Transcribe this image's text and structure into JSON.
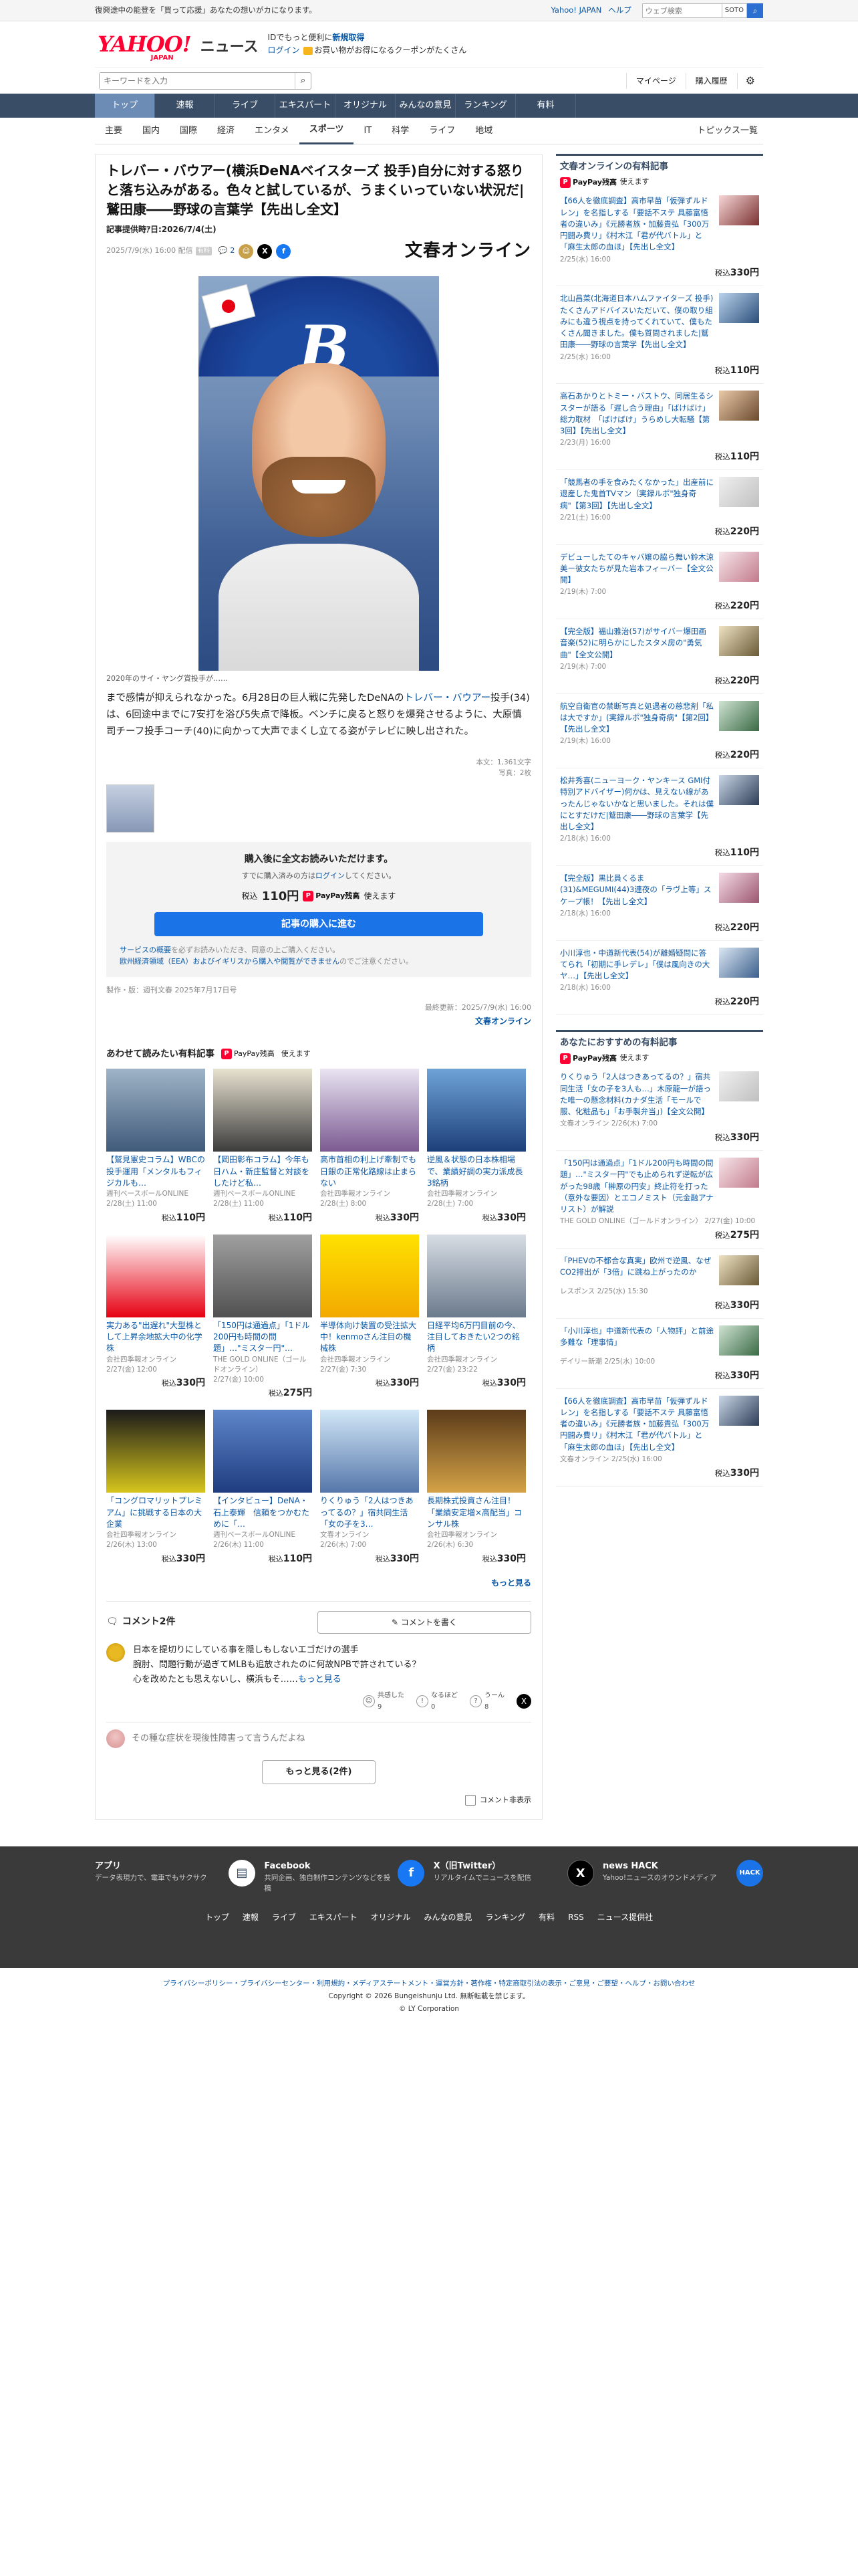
{
  "topbar": {
    "promo": "復興途中の能登を「買って応援」あなたの想いがカになります。",
    "yjapan": "Yahoo! JAPAN",
    "help": "ヘルプ",
    "search_placeholder": "ウェブ検索",
    "search_btn": "SOTO"
  },
  "header": {
    "logo": "YAHOO!",
    "logo_sub": "JAPAN",
    "logo_news": "ニュース",
    "login_line1": "IDでもっと便利に",
    "login_line1_link": "新規取得",
    "login_link": "ログイン",
    "coupon": "お買い物がお得になるクーポンがたくさん"
  },
  "search": {
    "placeholder": "キーワードを入力",
    "mypage": "マイページ",
    "purchased": "購入履歴"
  },
  "gnav": [
    "トップ",
    "速報",
    "ライブ",
    "エキスパート",
    "オリジナル",
    "みんなの意見",
    "ランキング",
    "有料"
  ],
  "snav": [
    "主要",
    "国内",
    "国際",
    "経済",
    "エンタメ",
    "スポーツ",
    "IT",
    "科学",
    "ライフ",
    "地域"
  ],
  "snav_topics": "トピックス一覧",
  "article": {
    "title": "トレバー・バウアー(横浜DeNAベイスターズ 投手)自分に対する怒りと落ち込みがある。色々と試しているが、うまくいっていない状況だ|鷲田康――野球の言葉学【先出し全文】",
    "source": "記事提供時ｱ日:2026/7/4(土)",
    "date": "2025/7/9(水) 16:00 配信",
    "badge": "有料",
    "comments": "2",
    "brand": "文春オンライン",
    "photo_caption": "2020年のサイ・ヤング賞投手が……",
    "lead_before": "まで感情が抑えられなかった。6月28日の巨人戦に先発したDeNAの",
    "lead_link": "トレバー・バウアー",
    "lead_after": "投手(34)は、6回途中までに7安打を浴び5失点で降板。ベンチに戻ると怒りを爆発させるように、大原慎司チーフ投手コーチ(40)に向かって大声でまくし立てる姿がテレビに映し出された。",
    "chars": "本文：1,361文字",
    "photos": "写真：2枚"
  },
  "pay": {
    "title": "購入後に全文お読みいただけます。",
    "sub_before": "すでに購入済みの方は",
    "sub_link": "ログイン",
    "sub_after": "してください。",
    "price_label": "税込",
    "price": "110円",
    "pp": "PayPay残高",
    "pp_use": "使えます",
    "buy": "記事の購入に進む",
    "note_link": "サービスの概要",
    "note_rest": "を必ずお読みいただき、同意の上ご購入ください。",
    "note2": "欧州経済領域（EEA）およびイギリスから購入や閲覧ができません",
    "note3": "のでご注意ください。"
  },
  "pubinfo": "製作・版：週刊文春 2025年7月17日号",
  "updated": "最終更新：2025/7/9(水) 16:00",
  "bunshun_link": "文春オンライン",
  "related": {
    "title": "あわせて読みたい有料記事",
    "pp": "PayPay残高",
    "pp_use": "使えます",
    "more": "もっと見る",
    "items": [
      {
        "title": "【鷲見憲史コラム】WBCの投手運用「メンタルもフィジカルも…",
        "src": "週刊ベースボールONLINE",
        "date": "2/28(土) 11:00",
        "price": "110円"
      },
      {
        "title": "【岡田彰布コラム】今年も日ハム・新庄監督と対談をしたけど私…",
        "src": "週刊ベースボールONLINE",
        "date": "2/28(土) 11:00",
        "price": "110円"
      },
      {
        "title": "高市首相の利上げ牽制でも日銀の正常化路線は止まらない",
        "src": "会社四季報オンライン",
        "date": "2/28(土) 8:00",
        "price": "330円"
      },
      {
        "title": "逆風＆状態の日本株相場で、業績好調の実力派成長3銘柄",
        "src": "会社四季報オンライン",
        "date": "2/28(土) 7:00",
        "price": "330円"
      },
      {
        "title": "実力ある\"出遅れ\"大型株として上昇余地拡大中の化学株",
        "src": "会社四季報オンライン",
        "date": "2/27(金) 12:00",
        "price": "330円"
      },
      {
        "title": "「150円は通過点」「1ドル200円も時間の問題」…\"ミスター円\"…",
        "src": "THE GOLD ONLINE（ゴールドオンライン）",
        "date": "2/27(金) 10:00",
        "price": "275円"
      },
      {
        "title": "半導体向け装置の受注拡大中！kenmoさん注目の機械株",
        "src": "会社四季報オンライン",
        "date": "2/27(金) 7:30",
        "price": "330円"
      },
      {
        "title": "日経平均6万円目前の今、注目しておきたい2つの銘柄",
        "src": "会社四季報オンライン",
        "date": "2/27(金) 23:22",
        "price": "330円"
      },
      {
        "title": "「コングロマリットプレミアム」に挑戦する日本の大企業",
        "src": "会社四季報オンライン",
        "date": "2/26(木) 13:00",
        "price": "330円"
      },
      {
        "title": "【インタビュー】DeNA・石上泰輝　信頼をつかむために「…",
        "src": "週刊ベースボールONLINE",
        "date": "2/26(木) 11:00",
        "price": "110円"
      },
      {
        "title": "りくりゅう「2人はつきあってるの？」宿共同生活「女の子を3…",
        "src": "文春オンライン",
        "date": "2/26(木) 7:00",
        "price": "330円"
      },
      {
        "title": "長期株式投資さん注目！「業績安定増×高配当」コンサル株",
        "src": "会社四季報オンライン",
        "date": "2/26(木) 6:30",
        "price": "330円"
      }
    ]
  },
  "comments": {
    "title": "コメント2件",
    "write": "コメントを書く",
    "c1_line1": "日本を提切りにしている事を隠しもしないエゴだけの選手",
    "c1_line2": "腕肘、問題行動が過ぎてMLBも追放されたのに何故NPBで許されている？",
    "c1_line3": "心を改めたとも思えないし、横浜もそ……",
    "c1_more": "もっと見る",
    "r1": "共感した",
    "r1n": "9",
    "r2": "なるほど",
    "r2n": "0",
    "r3": "うーん",
    "r3n": "8",
    "c2": "その種な症状を現後性障害って言うんだよね",
    "more_btn": "もっと見る(2件)",
    "hide": "コメント非表示"
  },
  "side1": {
    "title": "文春オンラインの有料記事",
    "pp": "PayPay残高",
    "pp_use": "使えます",
    "items": [
      {
        "title": "【66人を徹底調査】高市早苗「仮弾ずルドレン」を名指しする「要話不ステ 具藤富悟者の違いみ」《元勝者族・加藤貴弘「300万円闘み費リ」《村木江「君が代バトル」と「麻生太郎の血ほ」【先出し全文】",
        "date": "2/25(水) 16:00",
        "price": "330円"
      },
      {
        "title": "北山昌菜(北海道日本ハムファイターズ 投手)たくさんアドバイスいただいて、僕の取り組みにも違う視点を持ってくれていて、僕もたくさん聞きました。僕も質問されました|鷲田康――野球の言葉学【先出し全文】",
        "date": "2/25(水) 16:00",
        "price": "110円"
      },
      {
        "title": "高石あかりとトミー・バストウ、同居生るシスターが語る「遅し合う理由」「ばけばけ」総力取材　「ばけばけ」うらめし大転騒【第3回】【先出し全文】",
        "date": "2/23(月) 16:00",
        "price": "110円"
      },
      {
        "title": "「競馬者の手を食みたくなかった」出産前に退産した鬼首TVマン（実録ルポ\"独身奇病\"【第3回】【先出し全文】",
        "date": "2/21(土) 16:00",
        "price": "220円"
      },
      {
        "title": "デビューしたてのキャバ嬢の脇ら舞い鈴木涼美ー彼女たちが見た岩本フィーバー【全文公開】",
        "date": "2/19(木) 7:00",
        "price": "220円"
      },
      {
        "title": "【完全版】福山雅治(57)がサイバー爆田画音楽(52)に明らかにしたスタメ房の\"勇気曲\"【全文公開】",
        "date": "2/19(木) 7:00",
        "price": "220円"
      },
      {
        "title": "航空自衛官の禁断写真と処遇者の慈悲剤「私は大ですか」(実録ルポ\"独身奇病\"【第2回】【先出し全文】",
        "date": "2/19(木) 16:00",
        "price": "220円"
      },
      {
        "title": "松井秀喜(ニューヨーク・ヤンキース GMI付特別アドバイザー)何かは、見えない線があったんじゃないかなと思いました。それは僕にとすだけだ|鷲田康――野球の言葉学【先出し全文】",
        "date": "2/18(水) 16:00",
        "price": "110円"
      },
      {
        "title": "【完全版】黒比員くるま(31)&MEGUMI(44)3連夜の「ラヴ上等」スケープ帳！【先出し全文】",
        "date": "2/18(水) 16:00",
        "price": "220円"
      },
      {
        "title": "小川淳也・中道新代表(54)が離婚疑問に答てられ「初期に手レデレ」「僕は風向きの大ヤ…」【先出し全文】",
        "date": "2/18(水) 16:00",
        "price": "220円"
      }
    ]
  },
  "side2": {
    "title": "あなたにおすすめの有料記事",
    "pp": "PayPay残高",
    "pp_use": "使えます",
    "items": [
      {
        "title": "りくりゅう「2人はつきあってるの？」宿共同生活「女の子を3人も…」木原龍一が語った唯一の懸念材料(カナダ生活「モールで服、化粧品も」「お手製弁当」)【全文公開】",
        "date": "文春オンライン 2/26(木) 7:00",
        "price": "330円"
      },
      {
        "title": "「150円は通過点」「1ドル200円も時間の問題」…\"ミスター円\"でも止められず逆転が広がった98歳「榊原の円安」終止符を打った（意外な要因）とエコノミスト（元金融アナリスト）が解説",
        "date": "THE GOLD ONLINE（ゴールドオンライン） 2/27(金) 10:00",
        "price": "275円"
      },
      {
        "title": "「PHEVの不都合な真実」欧州で逆風、なぜCO2排出が「3倍」に跳ね上がったのか",
        "date": "レスポンス 2/25(水) 15:30",
        "price": "330円"
      },
      {
        "title": "「小川淳也」中道新代表の「人物評」と前途多難な「理事情」",
        "date": "デイリー新潮 2/25(水) 10:00",
        "price": "330円"
      },
      {
        "title": "【66人を徹底調査】高市早苗「仮弾ずルドレン」を名指しする「要話不ステ 具藤富悟者の違いみ」《元勝者族・加藤貴弘「300万円闘み費リ」《村木江「君が代バトル」と「麻生太郎の血ほ」【先出し全文】",
        "date": "文春オンライン 2/25(水) 16:00",
        "price": "330円"
      }
    ]
  },
  "footer": {
    "apps": [
      {
        "h": "アプリ",
        "p": "データ表現力で、電車でもサクサク"
      },
      {
        "h": "Facebook",
        "p": "共同企画、独自制作コンテンツなどを投稿"
      },
      {
        "h": "X（旧Twitter）",
        "p": "リアルタイムでニュースを配信"
      },
      {
        "h": "news HACK",
        "p": "Yahoo!ニュースのオウンドメディア"
      }
    ],
    "nav": [
      "トップ",
      "速報",
      "ライブ",
      "エキスパート",
      "オリジナル",
      "みんなの意見",
      "ランキング",
      "有料",
      "RSS",
      "ニュース提供社"
    ],
    "legal1": "プライバシーポリシー・プライバシーセンター・利用規約・メディアステートメント・運営方針・著作権・特定商取引法の表示・ご意見・ご要望・ヘルプ・お問い合わせ",
    "copyright": "Copyright © 2026 Bungeishunju Ltd. 無断転載を禁じます。",
    "corp": "© LY Corporation"
  }
}
